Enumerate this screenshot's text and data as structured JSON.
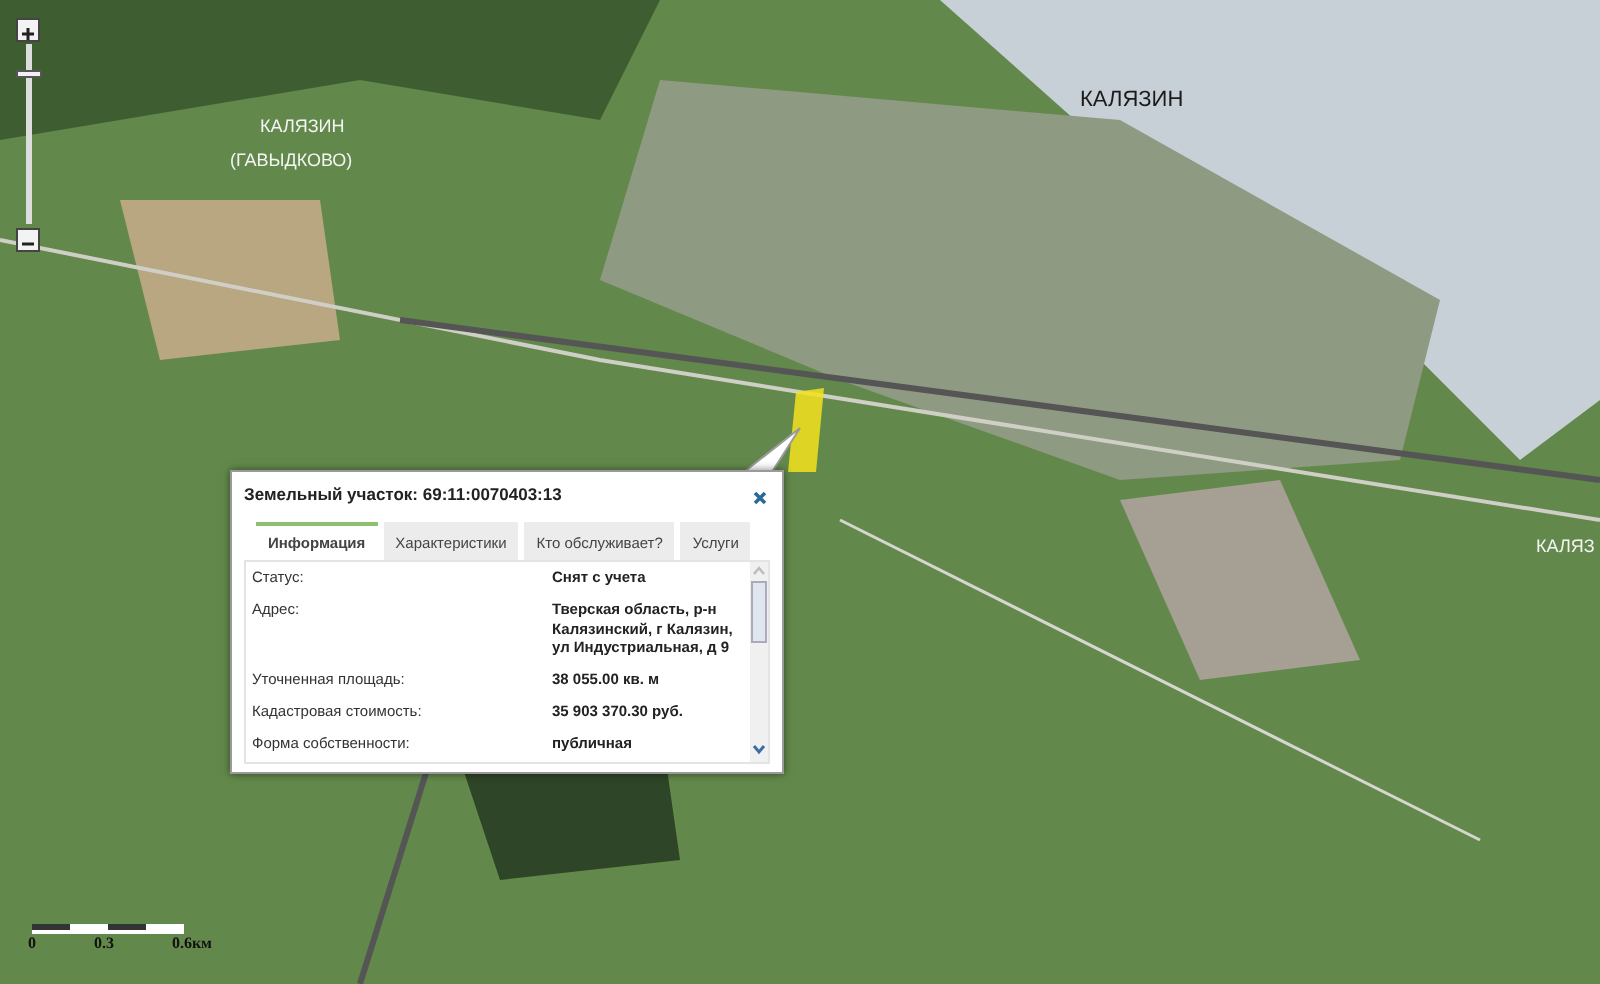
{
  "map": {
    "labels": [
      {
        "text": "КАЛЯЗИН",
        "kind": "city"
      },
      {
        "text": "КАЛЯЗИН",
        "kind": "village"
      },
      {
        "text": "(ГАВЫДКОВО)",
        "kind": "village"
      },
      {
        "text": "КАЛЯЗ",
        "kind": "edge"
      }
    ]
  },
  "zoom_control": {
    "level": 0.85
  },
  "scale_bar": {
    "ticks": [
      "0",
      "0.3",
      "0.6км"
    ]
  },
  "popup": {
    "title": "Земельный участок: 69:11:0070403:13",
    "tabs": [
      {
        "label": "Информация",
        "selected": true
      },
      {
        "label": "Характеристики",
        "selected": false
      },
      {
        "label": "Кто обслуживает?",
        "selected": false
      },
      {
        "label": "Услуги",
        "selected": false
      }
    ],
    "rows": [
      {
        "label": "Статус:",
        "value": "Снят с учета"
      },
      {
        "label": "Адрес:",
        "value": "Тверская область, р-н Калязинский, г Калязин, ул Индустриальная, д 9"
      },
      {
        "label": "Уточненная площадь:",
        "value": "38 055.00 кв. м"
      },
      {
        "label": "Кадастровая стоимость:",
        "value": "35 903 370.30 руб."
      },
      {
        "label": "Форма собственности:",
        "value": "публичная"
      }
    ]
  }
}
